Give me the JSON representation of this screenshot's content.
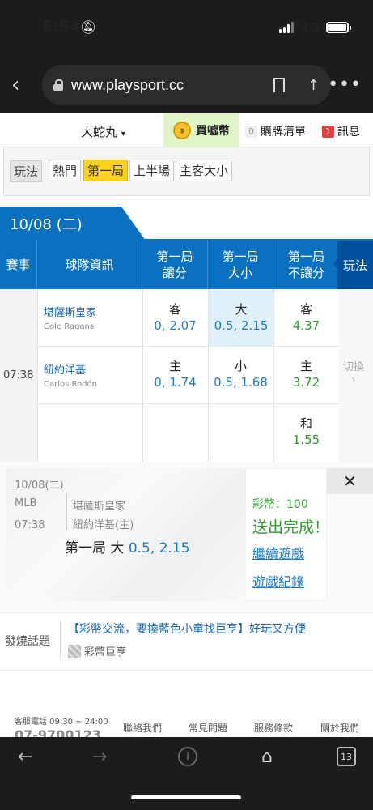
{
  "status": {
    "time": "6:54",
    "network": "4G"
  },
  "browser": {
    "url": "www.playsport.cc"
  },
  "header": {
    "nickname": "大蛇丸",
    "buy_coin_label": "買噓幣",
    "buy_list_label": "購牌清單",
    "buy_list_count": "0",
    "messages_label": "訊息",
    "messages_count": "1"
  },
  "filter": {
    "label": "玩法",
    "chips": [
      "熱門",
      "第一局",
      "上半場",
      "主客大小"
    ]
  },
  "date_tab": "10/08 (二)",
  "table": {
    "headers": {
      "event": "賽事",
      "team_info": "球隊資訊",
      "col1": "第一局\n讓分",
      "col2": "第一局\n大小",
      "col3": "第一局\n不讓分",
      "side": "玩法"
    },
    "time": "07:38",
    "away": {
      "name": "堪薩斯皇家",
      "pitcher": "Cole Ragans"
    },
    "home": {
      "name": "紐約洋基",
      "pitcher": "Carlos Rodón"
    },
    "rows": [
      {
        "spread_side": "客",
        "spread_odds": "0, 2.07",
        "total_side": "大",
        "total_odds": "0.5, 2.15",
        "ml_side": "客",
        "ml_odds": "4.37"
      },
      {
        "spread_side": "主",
        "spread_odds": "0, 1.74",
        "total_side": "小",
        "total_odds": "0.5, 1.68",
        "ml_side": "主",
        "ml_odds": "3.72"
      }
    ],
    "draw": {
      "side": "和",
      "odds": "1.55"
    },
    "switch_label": "切換",
    "switch_icon": "chevron-right-icon"
  },
  "popup": {
    "date": "10/08(二)",
    "league": "MLB",
    "time": "07:38",
    "away_team": "堪薩斯皇家",
    "home_team": "紐約洋基(主)",
    "bet_prefix": "第一局 大",
    "bet_value": "0.5, 2.15",
    "coins": "彩幣：100",
    "sent": "送出完成！",
    "continue_link": "繼續遊戲",
    "record_link": "遊戲紀錄",
    "close_icon": "close-icon"
  },
  "topic": {
    "label": "發燒話題",
    "title": "【彩幣交流，要換藍色小童找巨亨】好玩又方便",
    "author": "彩幣巨亨"
  },
  "footer": {
    "hotline": "客服電話 09:30 ~ 24:00",
    "phone": "07-9700123",
    "links": [
      "聯絡我們",
      "常見問題",
      "服務條款",
      "關於我們"
    ]
  },
  "toolbar": {
    "tab_count": "13"
  },
  "colors": {
    "brand_blue": "#0a70c0",
    "green": "#2e9b2e",
    "highlight": "#ffd21f"
  }
}
